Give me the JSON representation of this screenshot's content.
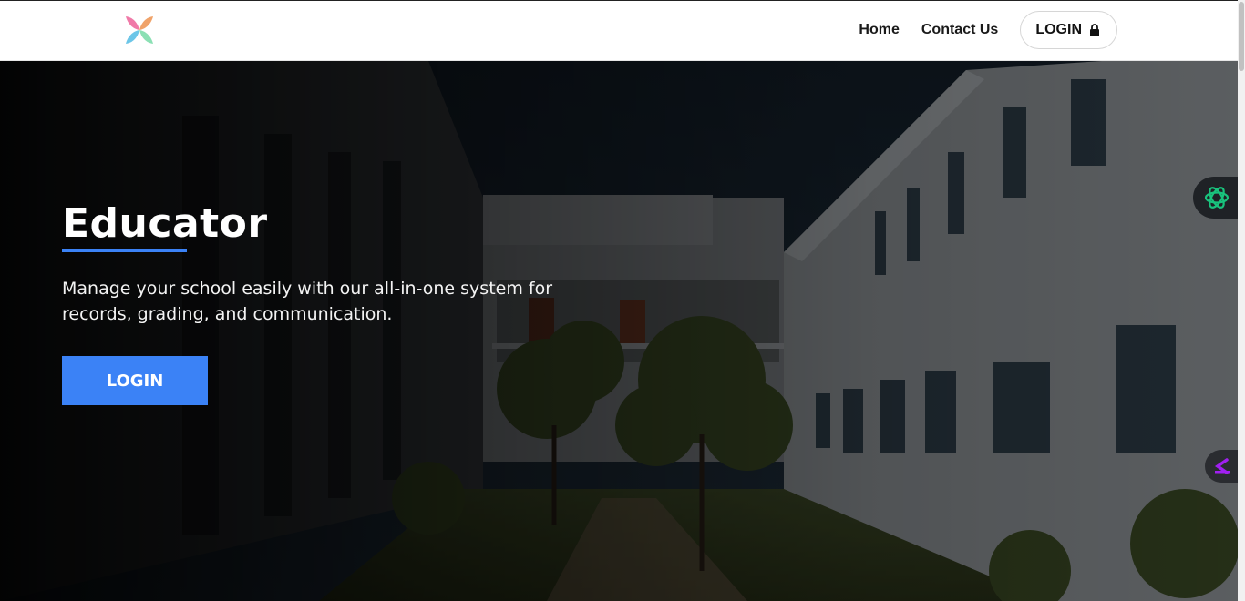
{
  "header": {
    "logo_icon": "butterfly-flower-logo",
    "nav": {
      "home": "Home",
      "contact": "Contact Us",
      "login": "LOGIN",
      "login_icon": "lock-icon"
    }
  },
  "hero": {
    "title": "Educator",
    "description": "Manage your school easily with our all-in-one system for records, grading, and communication.",
    "button_label": "LOGIN",
    "accent_color": "#3b82f6"
  },
  "widgets": {
    "ai_assistant_icon": "openai-knot-icon",
    "side_tool_icon": "angle-bracket-icon"
  }
}
